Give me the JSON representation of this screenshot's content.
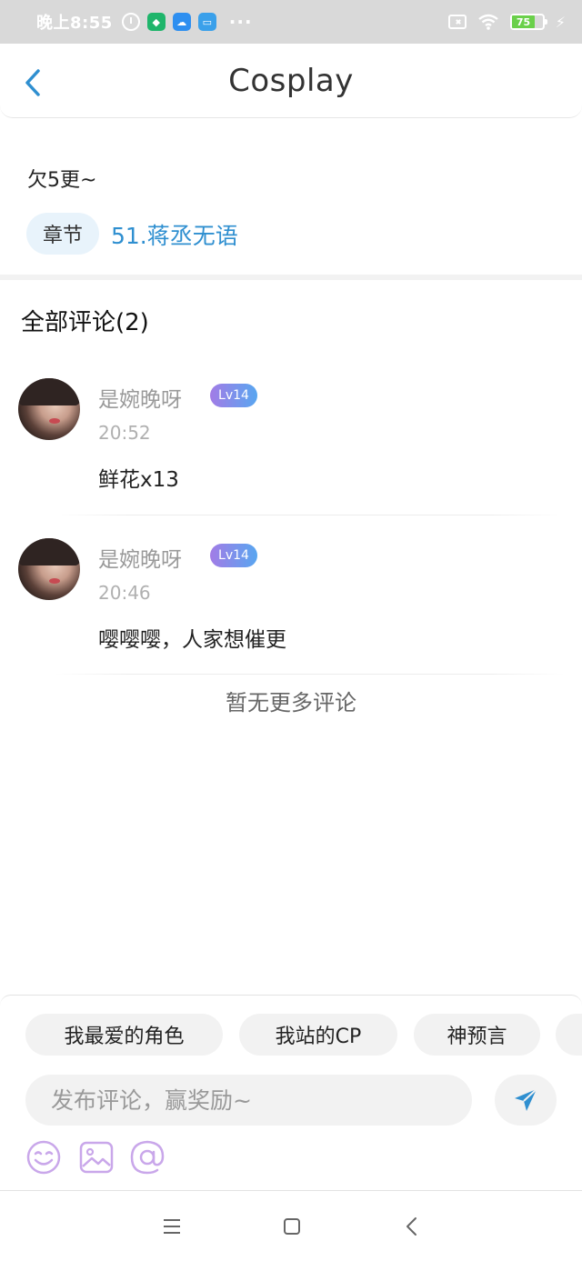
{
  "status_bar": {
    "time": "晚上8:55",
    "battery": "75",
    "battery_level": 0.75
  },
  "header": {
    "title": "Cosplay"
  },
  "chapter": {
    "note": "欠5更~",
    "tag": "章节",
    "link": "51.蒋丞无语"
  },
  "comments_section": {
    "title": "全部评论(2)",
    "items": [
      {
        "name": "是婉晚呀",
        "level": "Lv14",
        "time": "20:52",
        "text": "鲜花x13"
      },
      {
        "name": "是婉晚呀",
        "level": "Lv14",
        "time": "20:46",
        "text": "嘤嘤嘤，人家想催更"
      }
    ],
    "no_more": "暂无更多评论"
  },
  "composer": {
    "chips": [
      "我最爱的角色",
      "我站的CP",
      "神预言",
      ""
    ],
    "placeholder": "发布评论，赢奖励~"
  },
  "colors": {
    "accent": "#2f8fd0",
    "tag_bg": "#e8f3fb",
    "badge_gradient_start": "#a27ce6",
    "badge_gradient_end": "#58a6f0",
    "tool_icon": "#c9a7ea",
    "status_bar": "#d9d9d9"
  },
  "icons": {
    "back": "chevron-left-icon",
    "send": "send-icon",
    "emoji": "emoji-icon",
    "image": "image-icon",
    "mention": "at-icon"
  }
}
